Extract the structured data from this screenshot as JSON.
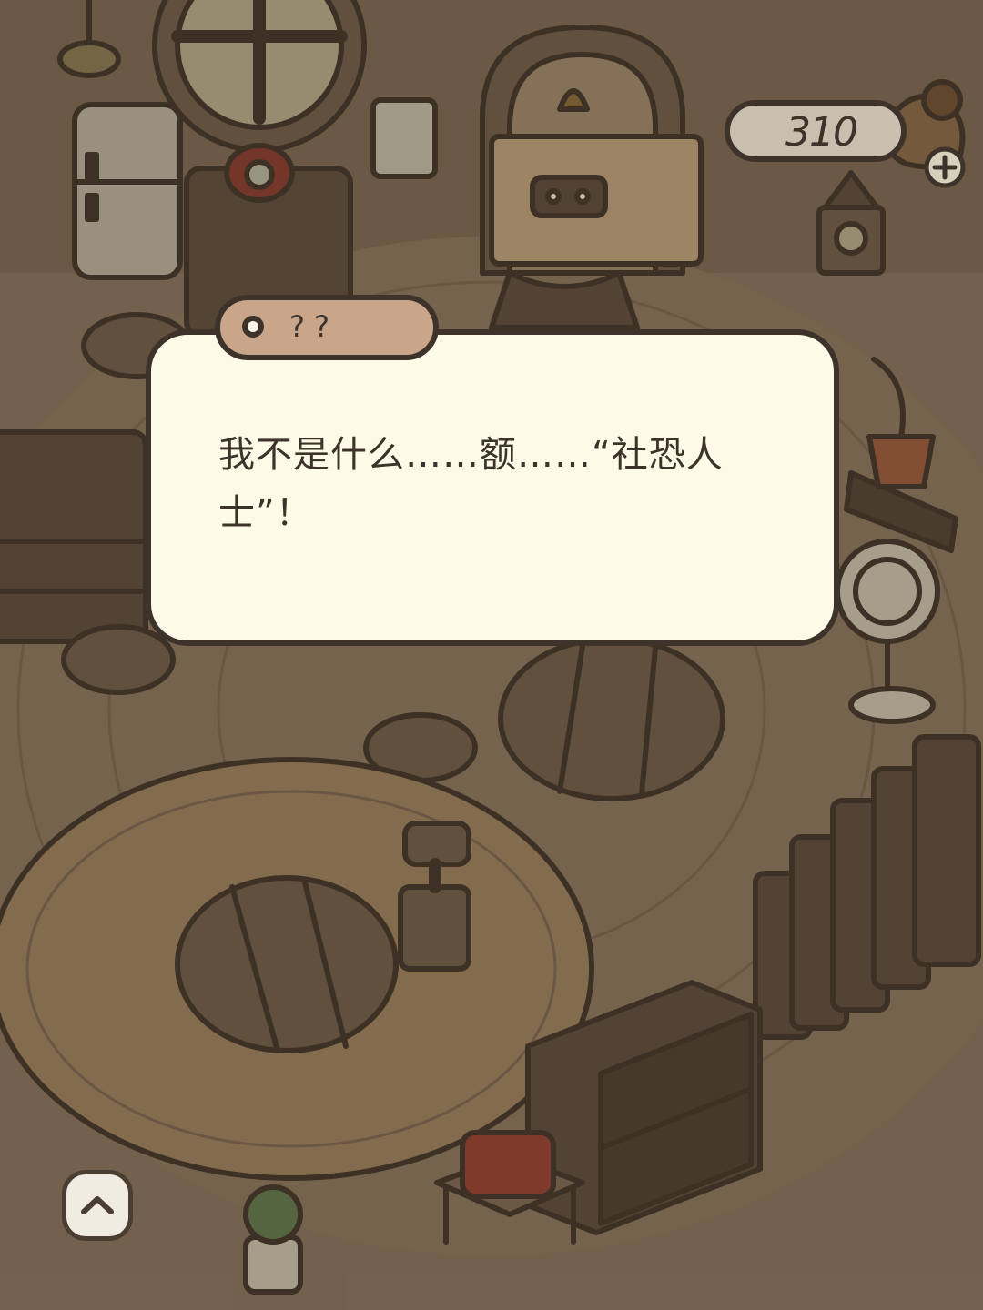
{
  "hud": {
    "coin_count": "310",
    "add_icon": "plus-icon",
    "currency_icon": "coin-pouch-icon"
  },
  "dialog": {
    "speaker": "??",
    "text": "我不是什么……额……“社恐人士”！"
  },
  "controls": {
    "expand_icon": "chevron-up-icon"
  },
  "colors": {
    "outline": "#3e332a",
    "dialog_bg": "#fdfbe7",
    "speaker_tab_bg": "#c9a68a",
    "floor": "#8a7560",
    "rug": "#9e8460"
  }
}
